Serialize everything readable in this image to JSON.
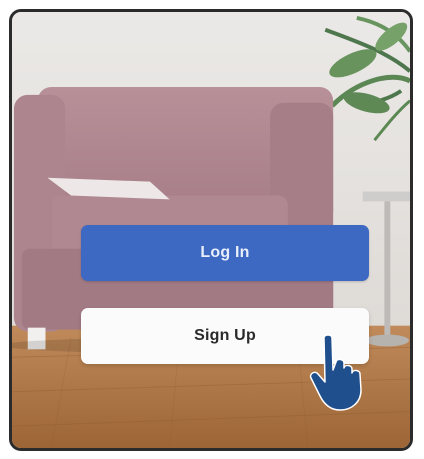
{
  "buttons": {
    "login_label": "Log In",
    "signup_label": "Sign Up"
  },
  "colors": {
    "login_button": "#3d69c3",
    "signup_button": "#fbfbfb",
    "hand_cursor": "#1f4f8c"
  },
  "icons": {
    "pointer": "hand-pointer-icon"
  }
}
